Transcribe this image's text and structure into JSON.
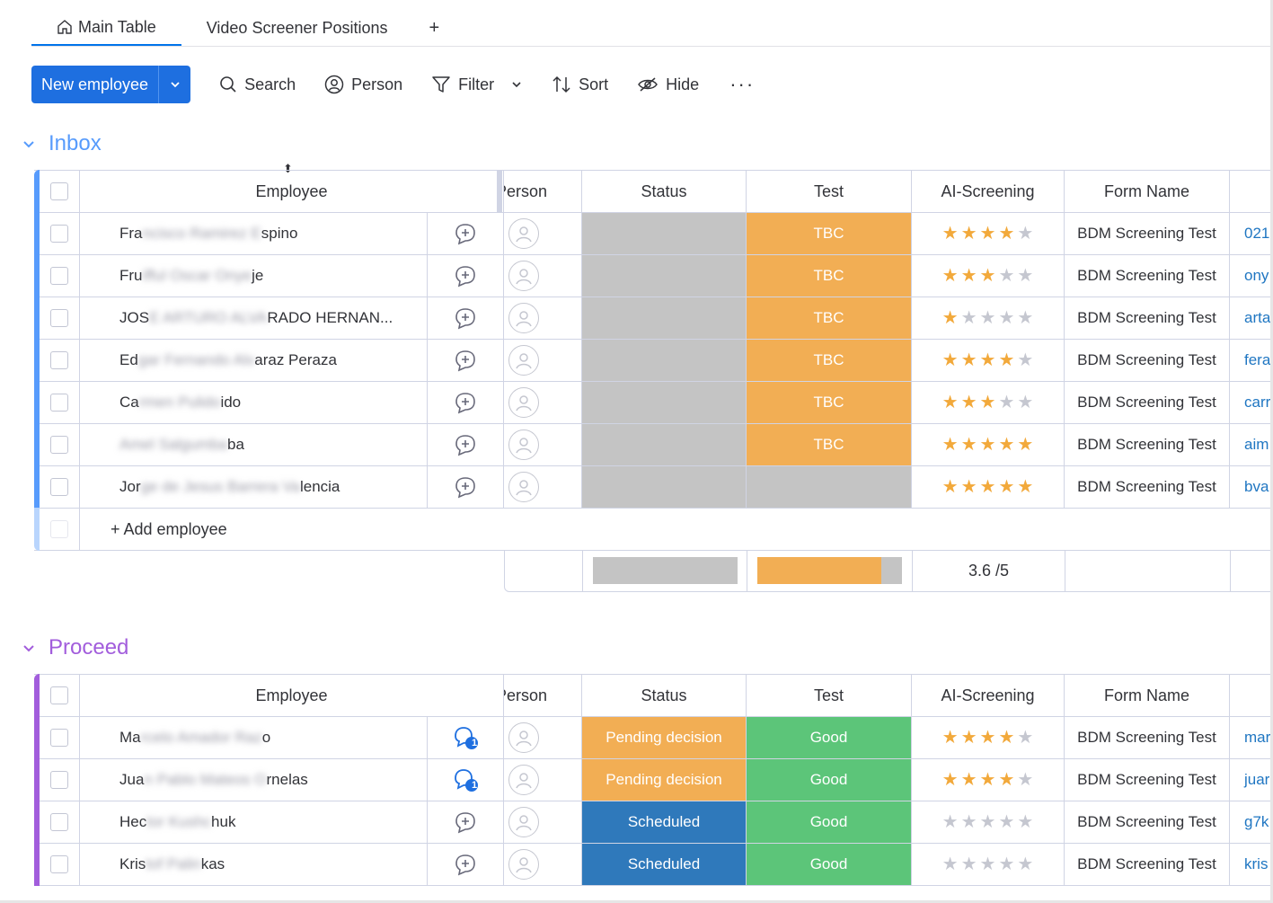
{
  "tabs": {
    "main": "Main Table",
    "video": "Video Screener Positions",
    "add": "+"
  },
  "toolbar": {
    "new_employee": "New employee",
    "search": "Search",
    "person": "Person",
    "filter": "Filter",
    "sort": "Sort",
    "hide": "Hide",
    "more": "···"
  },
  "colors": {
    "accent": "#1e6fe0",
    "inbox": "#579bfc",
    "proceed": "#a25ddc",
    "tbc": "#f2ae54",
    "good": "#5cc579",
    "pending": "#f2ae54",
    "scheduled": "#2f79bb",
    "empty": "#c4c4c4"
  },
  "columns": {
    "employee": "Employee",
    "person": "Person",
    "status": "Status",
    "test": "Test",
    "ai": "AI-Screening",
    "form": "Form Name"
  },
  "inbox": {
    "title": "Inbox",
    "add_label": "+ Add employee",
    "rating_summary": "3.6 /5",
    "rows": [
      {
        "name_a": "Fra",
        "name_b": "ncisco Ramirez E",
        "name_c": "spino",
        "status": "",
        "test": "TBC",
        "rating": 4,
        "form": "BDM Screening Test",
        "link": "021"
      },
      {
        "name_a": "Fru",
        "name_b": "ifful Oscar Onye",
        "name_c": "je",
        "status": "",
        "test": "TBC",
        "rating": 3,
        "form": "BDM Screening Test",
        "link": "ony"
      },
      {
        "name_a": "JOS",
        "name_b": "E ARTURO ALVA",
        "name_c": "RADO HERNAN...",
        "status": "",
        "test": "TBC",
        "rating": 1,
        "form": "BDM Screening Test",
        "link": "arta"
      },
      {
        "name_a": "Ed",
        "name_b": "gar Fernando Alv",
        "name_c": "araz Peraza",
        "status": "",
        "test": "TBC",
        "rating": 4,
        "form": "BDM Screening Test",
        "link": "fera"
      },
      {
        "name_a": "Ca",
        "name_b": "rmen Pulido",
        "name_c": "ido",
        "status": "",
        "test": "TBC",
        "rating": 3,
        "form": "BDM Screening Test",
        "link": "carr"
      },
      {
        "name_a": "",
        "name_b": "Amel Salgumba",
        "name_c": "ba",
        "status": "",
        "test": "TBC",
        "rating": 5,
        "form": "BDM Screening Test",
        "link": "aim"
      },
      {
        "name_a": "Jor",
        "name_b": "ge de Jesus Barrera Va",
        "name_c": "lencia",
        "status": "",
        "test": "",
        "rating": 5,
        "form": "BDM Screening Test",
        "link": "bva"
      }
    ]
  },
  "proceed": {
    "title": "Proceed",
    "rows": [
      {
        "name_a": "Ma",
        "name_b": "rcelo Amador Raz",
        "name_c": "o",
        "status": "Pending decision",
        "test": "Good",
        "rating": 4,
        "form": "BDM Screening Test",
        "link": "mar",
        "updates": "1"
      },
      {
        "name_a": "Jua",
        "name_b": "n Pablo Mateos O",
        "name_c": "rnelas",
        "status": "Pending decision",
        "test": "Good",
        "rating": 4,
        "form": "BDM Screening Test",
        "link": "juar",
        "updates": "1"
      },
      {
        "name_a": "Hec",
        "name_b": "tor Kushc",
        "name_c": "huk",
        "status": "Scheduled",
        "test": "Good",
        "rating": 0,
        "form": "BDM Screening Test",
        "link": "g7k",
        "updates": ""
      },
      {
        "name_a": "Kris",
        "name_b": "tof Palin",
        "name_c": "kas",
        "status": "Scheduled",
        "test": "Good",
        "rating": 0,
        "form": "BDM Screening Test",
        "link": "kris",
        "updates": ""
      }
    ]
  }
}
